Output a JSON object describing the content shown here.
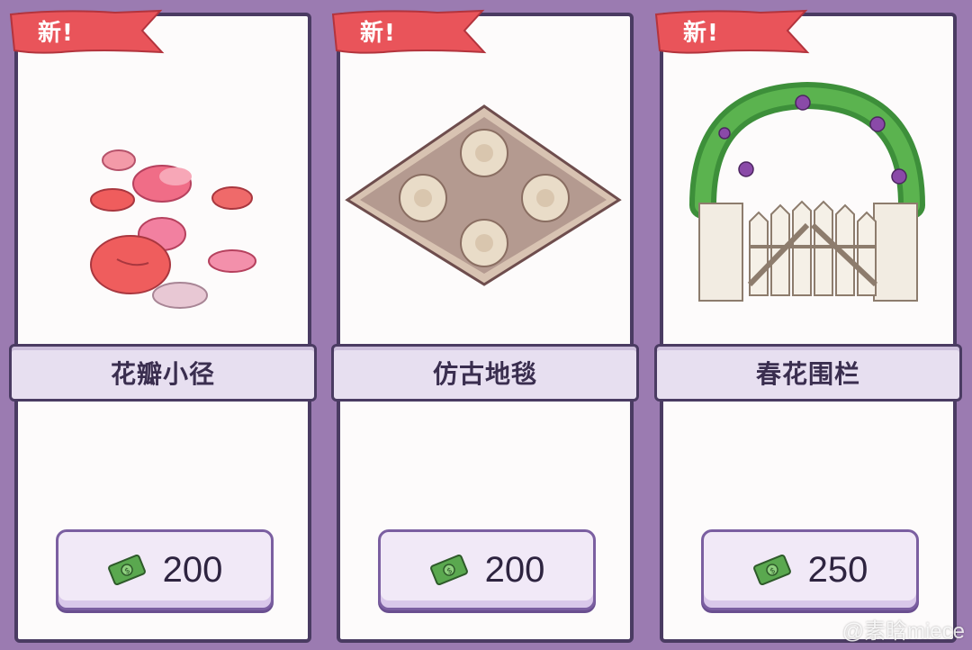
{
  "cards": [
    {
      "badge": "新!",
      "name": "花瓣小径",
      "price": "200",
      "icon": "petal-path-icon"
    },
    {
      "badge": "新!",
      "name": "仿古地毯",
      "price": "200",
      "icon": "antique-rug-icon"
    },
    {
      "badge": "新!",
      "name": "春花围栏",
      "price": "250",
      "icon": "spring-flower-fence-icon"
    }
  ],
  "currency_icon": "money-bill-icon",
  "watermark": "@素晗miece",
  "colors": {
    "background": "#9b7bb1",
    "ribbon": "#e9545a",
    "card": "#fdfbfb",
    "name_bar": "#e7dff0",
    "button": "#f1e9f7"
  }
}
